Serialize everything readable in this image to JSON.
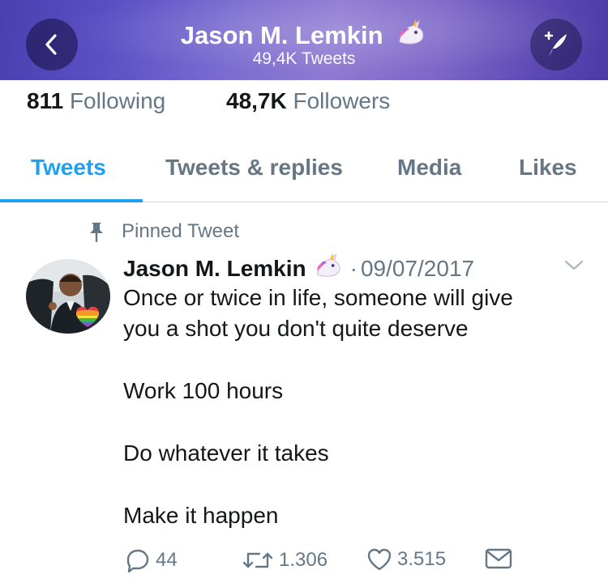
{
  "header": {
    "name": "Jason M. Lemkin",
    "tweet_count": "49,4K Tweets",
    "back_icon": "chevron-left-icon",
    "compose_icon": "compose-tweet-icon",
    "banner_colors": [
      "#4a3fb0",
      "#8f7ad2",
      "#4b3aa6"
    ]
  },
  "stats": {
    "following_count": "811",
    "following_label": "Following",
    "followers_count": "48,7K",
    "followers_label": "Followers"
  },
  "tabs": [
    {
      "label": "Tweets",
      "active": true
    },
    {
      "label": "Tweets & replies",
      "active": false
    },
    {
      "label": "Media",
      "active": false
    },
    {
      "label": "Likes",
      "active": false
    }
  ],
  "tweet": {
    "pinned_label": "Pinned Tweet",
    "author": "Jason M. Lemkin",
    "separator": "·",
    "date": "09/07/2017",
    "lines": [
      "Once or twice in life, someone will give",
      "you a shot you don't quite deserve",
      "Work 100 hours",
      "Do whatever it takes",
      "Make it happen"
    ],
    "replies": "44",
    "retweets": "1.306",
    "likes": "3.515"
  },
  "colors": {
    "accent": "#1da1f2",
    "secondary_text": "#657786",
    "primary_text": "#14171a"
  }
}
